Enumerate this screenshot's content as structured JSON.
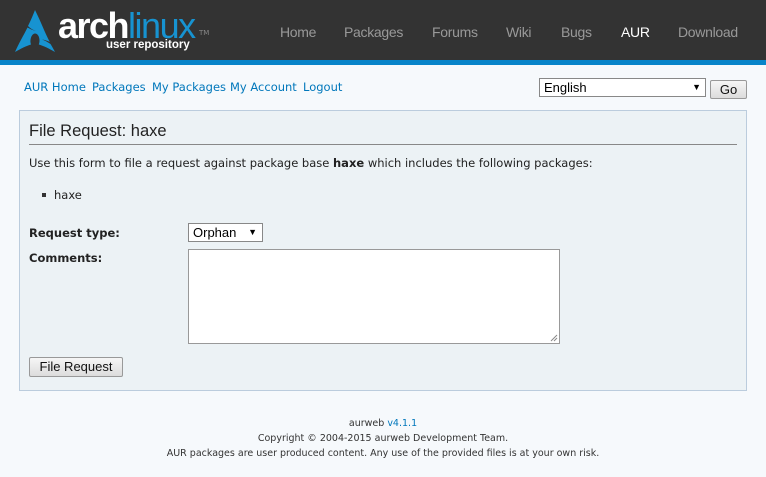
{
  "brand": {
    "word_main": "arch",
    "word_accent": "linux",
    "trademark": "TM",
    "subtitle": "user repository"
  },
  "topnav": [
    {
      "label": "Home",
      "active": false
    },
    {
      "label": "Packages",
      "active": false
    },
    {
      "label": "Forums",
      "active": false
    },
    {
      "label": "Wiki",
      "active": false
    },
    {
      "label": "Bugs",
      "active": false
    },
    {
      "label": "AUR",
      "active": true
    },
    {
      "label": "Download",
      "active": false
    }
  ],
  "subnav": [
    "AUR Home",
    "Packages",
    "My Packages",
    "My Account",
    "Logout"
  ],
  "language": {
    "selected": "English",
    "go_label": "Go"
  },
  "form": {
    "title": "File Request: haxe",
    "intro_before": "Use this form to file a request against package base ",
    "intro_package": "haxe",
    "intro_after": " which includes the following packages:",
    "packages": [
      "haxe"
    ],
    "request_type_label": "Request type:",
    "request_type_value": "Orphan",
    "comments_label": "Comments:",
    "comments_value": "",
    "submit_label": "File Request"
  },
  "footer": {
    "app_name": "aurweb",
    "version": "v4.1.1",
    "copyright": "Copyright © 2004-2015 aurweb Development Team.",
    "notice": "AUR packages are user produced content. Any use of the provided files is at your own risk."
  },
  "colors": {
    "header_bg": "#333333",
    "accent": "#1793d1",
    "link": "#0077bb",
    "box_bg": "#ecf2f5"
  }
}
